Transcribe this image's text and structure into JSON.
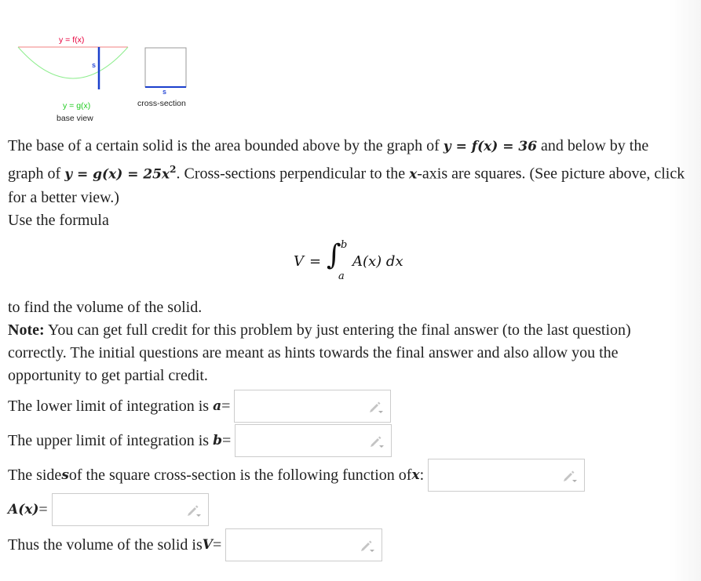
{
  "figure": {
    "base_view": {
      "top_curve_label": "y = f(x)",
      "bottom_curve_label": "y = g(x)",
      "side_label": "s",
      "caption": "base view"
    },
    "cross_section": {
      "side_label": "s",
      "caption": "cross-section"
    },
    "colors": {
      "f_curve": "#f08080",
      "f_label": "#e8003c",
      "g_curve": "#90ee90",
      "g_label": "#22cc22",
      "side": "#1a3fcc",
      "square_outline": "#999999"
    }
  },
  "problem": {
    "line1_a": "The base of a certain solid is the area bounded above by the graph of ",
    "line1_eq": "y = f(x) = 36",
    "line1_b": " and below by the",
    "line2_a": "graph of ",
    "line2_eq": "y = g(x) = 25x",
    "line2_exp": "2",
    "line2_b": ". Cross-sections perpendicular to the ",
    "line2_x": "x",
    "line2_c": "-axis are squares. (See picture above, click",
    "line3": "for a better view.)",
    "line4": "Use the formula"
  },
  "formula": {
    "lhs": "V",
    "equals": "=",
    "integral": "∫",
    "upper": "b",
    "lower": "a",
    "integrand": "A(x) dx"
  },
  "after": {
    "line1": "to find the volume of the solid.",
    "note_label": "Note:",
    "note_line1": " You can get full credit for this problem by just entering the final answer (to the last question)",
    "note_line2": "correctly. The initial questions are meant as hints towards the final answer and also allow you the",
    "note_line3": "opportunity to get partial credit."
  },
  "questions": [
    {
      "prefix": "The lower limit of integration is ",
      "var": "a",
      "suffix": " =",
      "value": "",
      "placeholder": ""
    },
    {
      "prefix": "The upper limit of integration is ",
      "var": "b",
      "suffix": " =",
      "value": "",
      "placeholder": ""
    },
    {
      "prefix": "The side ",
      "var": "s",
      "mid": " of the square cross-section is the following function of ",
      "var2": "x",
      "suffix": ":",
      "value": "",
      "placeholder": ""
    },
    {
      "prefix": "",
      "var": "A(x)",
      "suffix": "=",
      "value": "",
      "placeholder": ""
    },
    {
      "prefix": "Thus the volume of the solid is ",
      "var": "V",
      "suffix": " =",
      "value": "",
      "placeholder": ""
    }
  ],
  "icons": {
    "answer_tool": "pencil-dropdown-icon"
  }
}
